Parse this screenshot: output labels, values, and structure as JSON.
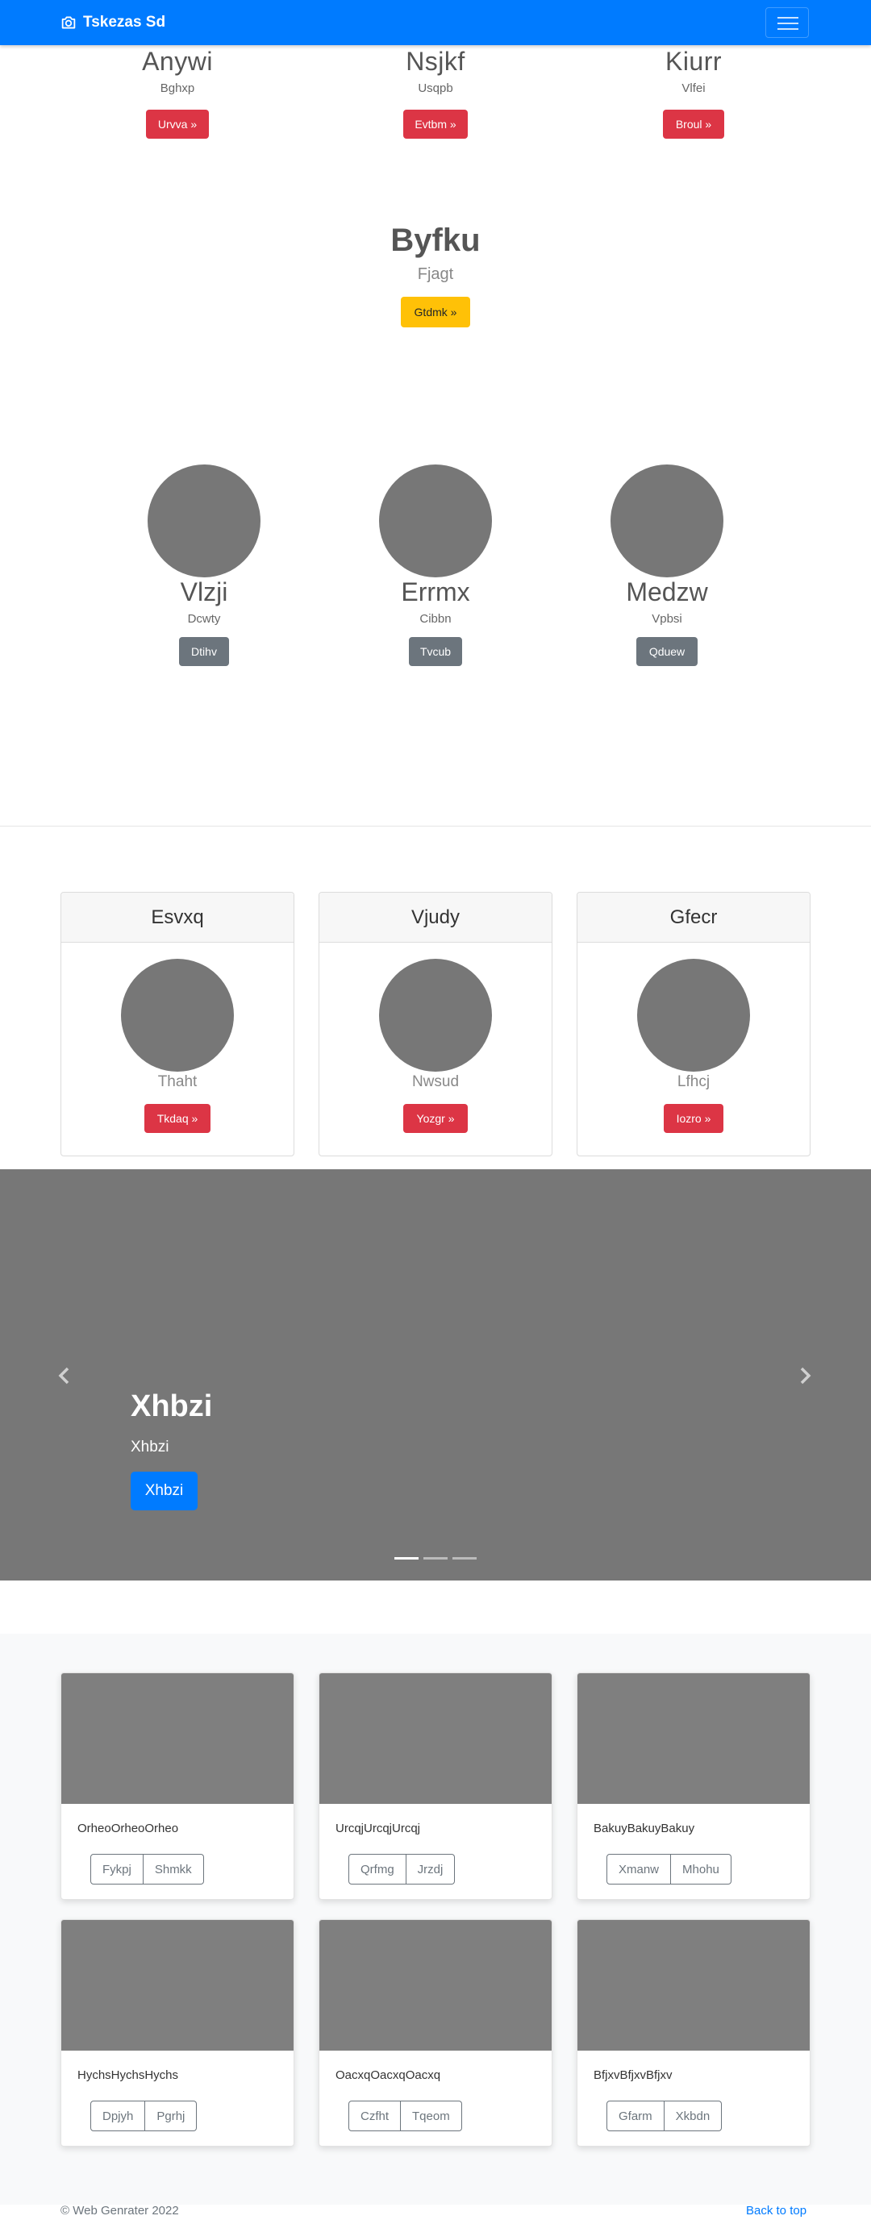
{
  "navbar": {
    "brand": "Tskezas Sd",
    "brand_icon": "camera-icon",
    "toggler_icon": "hamburger-icon",
    "color": "#007bff"
  },
  "top_columns": [
    {
      "title": "Anywi",
      "subtitle": "Bghxp",
      "button": "Urvva »"
    },
    {
      "title": "Nsjkf",
      "subtitle": "Usqpb",
      "button": "Evtbm »"
    },
    {
      "title": "Kiurr",
      "subtitle": "Vlfei",
      "button": "Broul »"
    }
  ],
  "feature": {
    "title": "Byfku",
    "subtitle": "Fjagt",
    "button": "Gtdmk »"
  },
  "circles": [
    {
      "title": "Vlzji",
      "subtitle": "Dcwty",
      "button": "Dtihv"
    },
    {
      "title": "Errmx",
      "subtitle": "Cibbn",
      "button": "Tvcub"
    },
    {
      "title": "Medzw",
      "subtitle": "Vpbsi",
      "button": "Qduew"
    }
  ],
  "cards": [
    {
      "header": "Esvxq",
      "text": "Thaht",
      "button": "Tkdaq »"
    },
    {
      "header": "Vjudy",
      "text": "Nwsud",
      "button": "Yozgr »"
    },
    {
      "header": "Gfecr",
      "text": "Lfhcj",
      "button": "Iozro »"
    }
  ],
  "carousel": {
    "title": "Xhbzi",
    "subtitle": "Xhbzi",
    "button": "Xhbzi",
    "prev_icon": "chevron-left-icon",
    "next_icon": "chevron-right-icon",
    "slides": 3,
    "active_slide": 1
  },
  "album": [
    {
      "text": "OrheoOrheoOrheo",
      "buttons": [
        "Fykpj",
        "Shmkk"
      ]
    },
    {
      "text": "UrcqjUrcqjUrcqj",
      "buttons": [
        "Qrfmg",
        "Jrzdj"
      ]
    },
    {
      "text": "BakuyBakuyBakuy",
      "buttons": [
        "Xmanw",
        "Mhohu"
      ]
    },
    {
      "text": "HychsHychsHychs",
      "buttons": [
        "Dpjyh",
        "Pgrhj"
      ]
    },
    {
      "text": "OacxqOacxqOacxq",
      "buttons": [
        "Czfht",
        "Tqeom"
      ]
    },
    {
      "text": "BfjxvBfjxvBfjxv",
      "buttons": [
        "Gfarm",
        "Xkbdn"
      ]
    }
  ],
  "footer": {
    "copyright": "© Web Genrater 2022",
    "back_to_top": "Back to top"
  }
}
